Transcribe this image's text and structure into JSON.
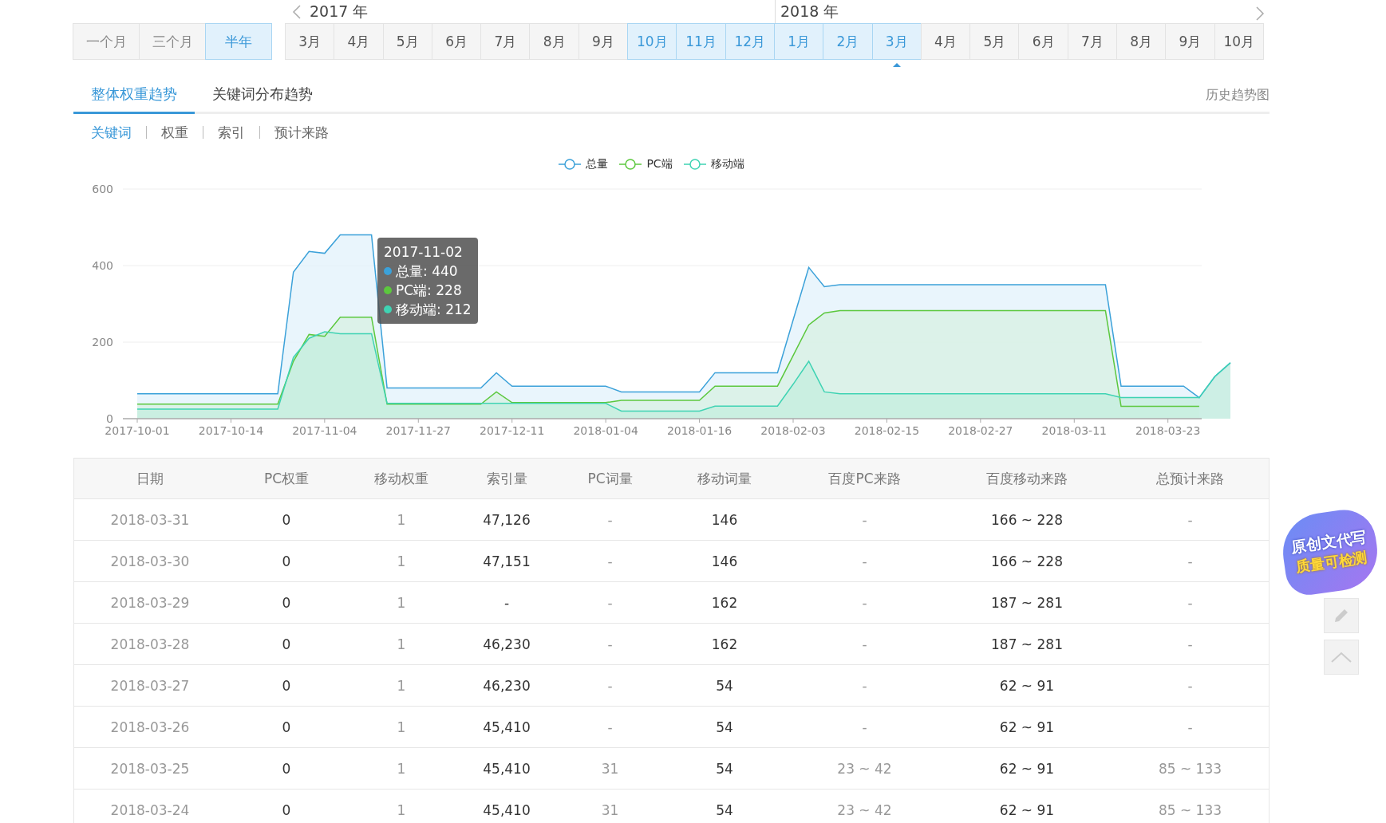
{
  "range_buttons": [
    {
      "label": "一个月",
      "selected": false
    },
    {
      "label": "三个月",
      "selected": false
    },
    {
      "label": "半年",
      "selected": true
    }
  ],
  "years": [
    {
      "label": "2017 年",
      "months": [
        {
          "label": "3月",
          "selected": false,
          "current": false
        },
        {
          "label": "4月",
          "selected": false,
          "current": false
        },
        {
          "label": "5月",
          "selected": false,
          "current": false
        },
        {
          "label": "6月",
          "selected": false,
          "current": false
        },
        {
          "label": "7月",
          "selected": false,
          "current": false
        },
        {
          "label": "8月",
          "selected": false,
          "current": false
        },
        {
          "label": "9月",
          "selected": false,
          "current": false
        },
        {
          "label": "10月",
          "selected": true,
          "current": false
        },
        {
          "label": "11月",
          "selected": true,
          "current": false
        },
        {
          "label": "12月",
          "selected": true,
          "current": false
        }
      ]
    },
    {
      "label": "2018 年",
      "months": [
        {
          "label": "1月",
          "selected": true,
          "current": false
        },
        {
          "label": "2月",
          "selected": true,
          "current": false
        },
        {
          "label": "3月",
          "selected": true,
          "current": true
        },
        {
          "label": "4月",
          "selected": false,
          "current": false
        },
        {
          "label": "5月",
          "selected": false,
          "current": false
        },
        {
          "label": "6月",
          "selected": false,
          "current": false
        },
        {
          "label": "7月",
          "selected": false,
          "current": false
        },
        {
          "label": "8月",
          "selected": false,
          "current": false
        },
        {
          "label": "9月",
          "selected": false,
          "current": false
        },
        {
          "label": "10月",
          "selected": false,
          "current": false
        }
      ]
    }
  ],
  "tabs": [
    {
      "label": "整体权重趋势",
      "selected": true
    },
    {
      "label": "关键词分布趋势",
      "selected": false
    }
  ],
  "history_link": "历史趋势图",
  "subtabs": [
    {
      "label": "关键词",
      "selected": true
    },
    {
      "label": "权重",
      "selected": false
    },
    {
      "label": "索引",
      "selected": false
    },
    {
      "label": "预计来路",
      "selected": false
    }
  ],
  "chart": {
    "chart_data": {
      "type": "area",
      "categories": [
        "2017-10-01",
        null,
        null,
        null,
        null,
        null,
        "2017-10-14",
        null,
        null,
        null,
        null,
        null,
        "2017-11-04",
        null,
        null,
        null,
        null,
        null,
        "2017-11-27",
        null,
        null,
        null,
        null,
        null,
        "2017-12-11",
        null,
        null,
        null,
        null,
        null,
        "2018-01-04",
        null,
        null,
        null,
        null,
        null,
        "2018-01-16",
        null,
        null,
        null,
        null,
        null,
        "2018-02-03",
        null,
        null,
        null,
        null,
        null,
        "2018-02-15",
        null,
        null,
        null,
        null,
        null,
        "2018-02-27",
        null,
        null,
        null,
        null,
        null,
        "2018-03-11",
        null,
        null,
        null,
        null,
        null,
        "2018-03-23",
        null,
        null,
        null,
        null
      ],
      "series": [
        {
          "name": "总量",
          "color": "#3ba1d9",
          "values": [
            65,
            65,
            65,
            65,
            65,
            65,
            65,
            65,
            65,
            65,
            383,
            437,
            432,
            480,
            480,
            480,
            80,
            80,
            80,
            80,
            80,
            80,
            80,
            120,
            85,
            85,
            85,
            85,
            85,
            85,
            85,
            70,
            70,
            70,
            70,
            70,
            70,
            120,
            120,
            120,
            120,
            120,
            258,
            395,
            345,
            350,
            350,
            350,
            350,
            350,
            350,
            350,
            350,
            350,
            350,
            350,
            350,
            350,
            350,
            350,
            350,
            350,
            350,
            85,
            85,
            85,
            85,
            85,
            55,
            110,
            146
          ]
        },
        {
          "name": "PC端",
          "color": "#5cc83e",
          "values": [
            38,
            38,
            38,
            38,
            38,
            38,
            38,
            38,
            38,
            38,
            150,
            220,
            215,
            265,
            265,
            265,
            38,
            38,
            38,
            38,
            38,
            38,
            38,
            70,
            42,
            42,
            42,
            42,
            42,
            42,
            42,
            48,
            48,
            48,
            48,
            48,
            48,
            85,
            85,
            85,
            85,
            85,
            165,
            245,
            276,
            282,
            282,
            282,
            282,
            282,
            282,
            282,
            282,
            282,
            282,
            282,
            282,
            282,
            282,
            282,
            282,
            282,
            282,
            32,
            32,
            32,
            32,
            32,
            32,
            null,
            null
          ]
        },
        {
          "name": "移动端",
          "color": "#3fd3b3",
          "values": [
            25,
            25,
            25,
            25,
            25,
            25,
            25,
            25,
            25,
            25,
            160,
            210,
            227,
            222,
            222,
            222,
            40,
            40,
            40,
            40,
            40,
            40,
            40,
            40,
            40,
            40,
            40,
            40,
            40,
            40,
            40,
            20,
            20,
            20,
            20,
            20,
            20,
            33,
            33,
            33,
            33,
            33,
            90,
            150,
            70,
            65,
            65,
            65,
            65,
            65,
            65,
            65,
            65,
            65,
            65,
            65,
            65,
            65,
            65,
            65,
            65,
            65,
            65,
            55,
            55,
            55,
            55,
            55,
            55,
            110,
            146
          ]
        }
      ],
      "ylim": [
        0,
        600
      ],
      "yticks": [
        0,
        200,
        400,
        600
      ]
    },
    "tooltip": {
      "title": "2017-11-02",
      "rows": [
        {
          "text": "总量: 440",
          "color": "#3ba1d9"
        },
        {
          "text": "PC端: 228",
          "color": "#5cc83e"
        },
        {
          "text": "移动端: 212",
          "color": "#3fd3b3"
        }
      ]
    }
  },
  "table": {
    "columns": [
      {
        "label": "日期",
        "muted": true
      },
      {
        "label": "PC权重",
        "muted": false
      },
      {
        "label": "移动权重",
        "muted": true
      },
      {
        "label": "索引量",
        "muted": false
      },
      {
        "label": "PC词量",
        "muted": true
      },
      {
        "label": "移动词量",
        "muted": false
      },
      {
        "label": "百度PC来路",
        "muted": true
      },
      {
        "label": "百度移动来路",
        "muted": false
      },
      {
        "label": "总预计来路",
        "muted": true
      }
    ],
    "rows": [
      [
        "2018-03-31",
        "0",
        "1",
        "47,126",
        "-",
        "146",
        "-",
        "166 ~ 228",
        "-"
      ],
      [
        "2018-03-30",
        "0",
        "1",
        "47,151",
        "-",
        "146",
        "-",
        "166 ~ 228",
        "-"
      ],
      [
        "2018-03-29",
        "0",
        "1",
        "-",
        "-",
        "162",
        "-",
        "187 ~ 281",
        "-"
      ],
      [
        "2018-03-28",
        "0",
        "1",
        "46,230",
        "-",
        "162",
        "-",
        "187 ~ 281",
        "-"
      ],
      [
        "2018-03-27",
        "0",
        "1",
        "46,230",
        "-",
        "54",
        "-",
        "62 ~ 91",
        "-"
      ],
      [
        "2018-03-26",
        "0",
        "1",
        "45,410",
        "-",
        "54",
        "-",
        "62 ~ 91",
        "-"
      ],
      [
        "2018-03-25",
        "0",
        "1",
        "45,410",
        "31",
        "54",
        "23 ~ 42",
        "62 ~ 91",
        "85 ~ 133"
      ],
      [
        "2018-03-24",
        "0",
        "1",
        "45,410",
        "31",
        "54",
        "23 ~ 42",
        "62 ~ 91",
        "85 ~ 133"
      ]
    ]
  },
  "promo_badge": {
    "line_1": "原创文代写",
    "line_2": "质量可检测"
  }
}
